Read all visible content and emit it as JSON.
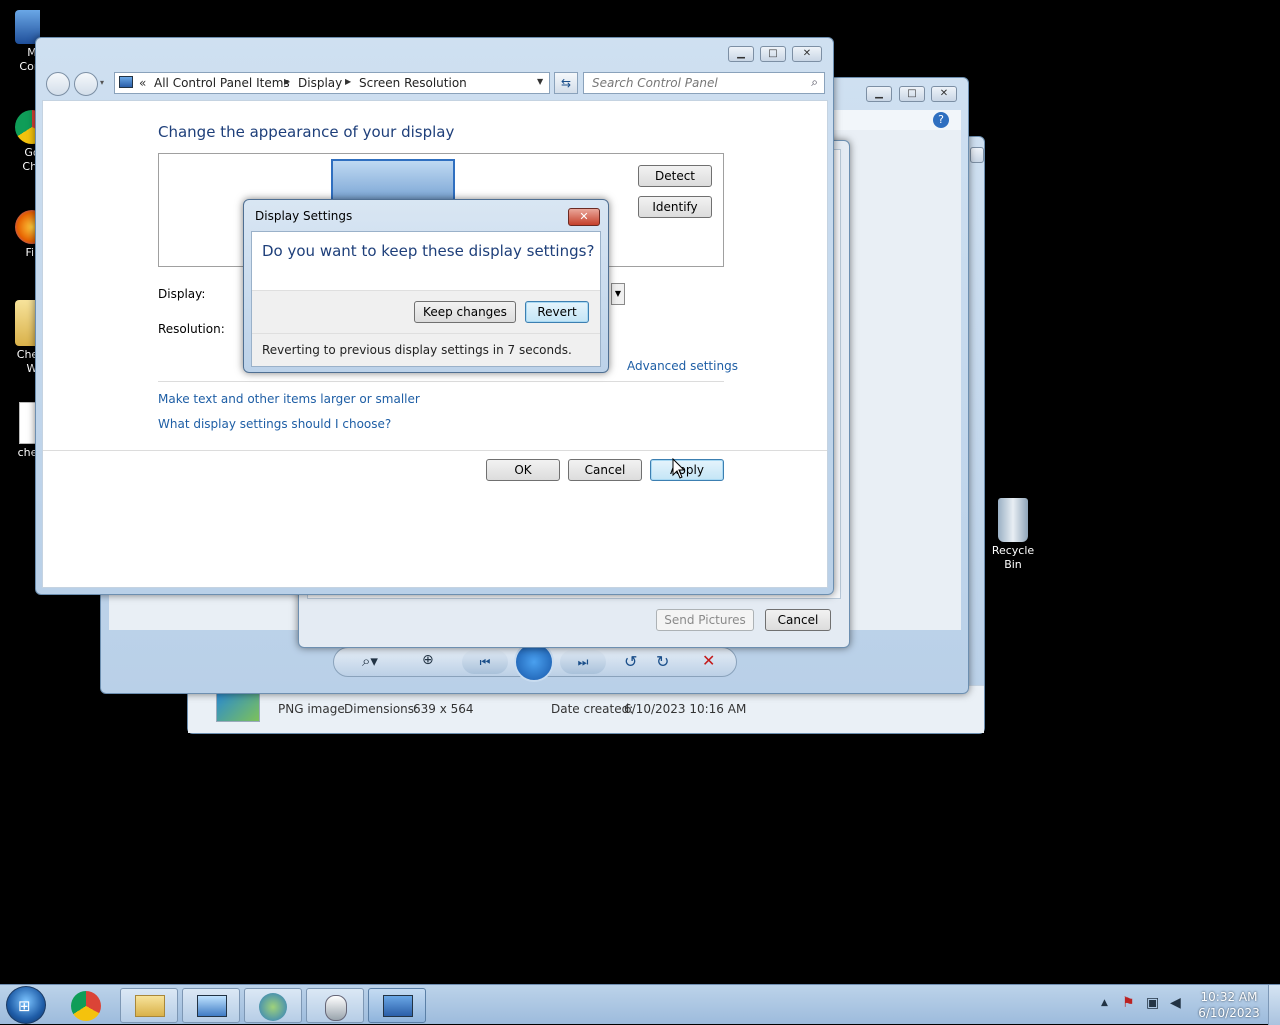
{
  "desktop": {
    "icons_left": [
      {
        "label": "M\nCom",
        "icon": "computer-icon"
      },
      {
        "label": "Go\nChr",
        "icon": "chrome-icon"
      },
      {
        "label": "Fir",
        "icon": "firefox-icon"
      },
      {
        "label": "Chew\nW",
        "icon": "folder-icon"
      },
      {
        "label": "chew",
        "icon": "document-icon"
      }
    ],
    "recycle_bin": "Recycle Bin"
  },
  "photo_viewer": {
    "file_type": "PNG image",
    "dimensions_label": "Dimensions:",
    "dimensions_value": "639 x 564",
    "date_label": "Date created:",
    "date_value": "6/10/2023 10:16 AM"
  },
  "print_dialog": {
    "send_pictures": "Send Pictures",
    "cancel": "Cancel"
  },
  "control_panel": {
    "breadcrumb": [
      "All Control Panel Items",
      "Display",
      "Screen Resolution"
    ],
    "breadcrumb_prefix": "«",
    "search_placeholder": "Search Control Panel",
    "heading": "Change the appearance of your display",
    "detect": "Detect",
    "identify": "Identify",
    "display_label": "Display:",
    "resolution_label": "Resolution:",
    "advanced_settings": "Advanced settings",
    "link_text_size": "Make text and other items larger or smaller",
    "link_what_settings": "What display settings should I choose?",
    "ok": "OK",
    "cancel": "Cancel",
    "apply": "Apply"
  },
  "dialog": {
    "title": "Display Settings",
    "question": "Do you want to keep these display settings?",
    "keep": "Keep changes",
    "revert": "Revert",
    "countdown": "Reverting to previous display settings in 7 seconds."
  },
  "taskbar": {
    "time": "10:32 AM",
    "date": "6/10/2023"
  }
}
